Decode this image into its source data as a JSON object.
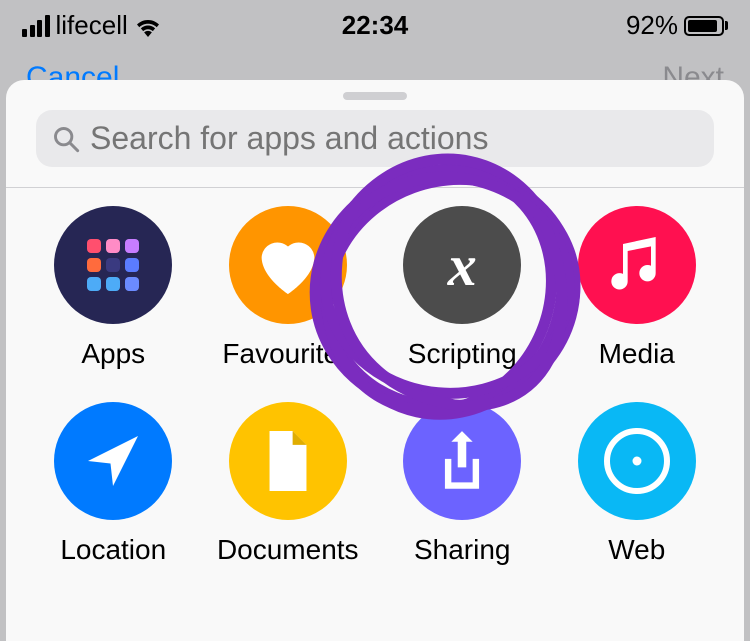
{
  "statusBar": {
    "carrier": "lifecell",
    "time": "22:34",
    "batteryPct": "92%"
  },
  "nav": {
    "cancel": "Cancel",
    "next": "Next"
  },
  "search": {
    "placeholder": "Search for apps and actions"
  },
  "categories": [
    {
      "label": "Apps"
    },
    {
      "label": "Favourites"
    },
    {
      "label": "Scripting"
    },
    {
      "label": "Media"
    },
    {
      "label": "Location"
    },
    {
      "label": "Documents"
    },
    {
      "label": "Sharing"
    },
    {
      "label": "Web"
    }
  ]
}
